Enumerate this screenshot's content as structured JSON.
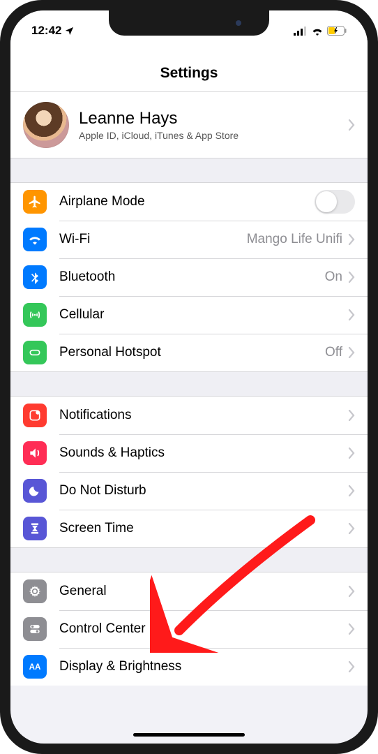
{
  "status": {
    "time": "12:42",
    "location_glyph": "➤"
  },
  "page": {
    "title": "Settings"
  },
  "profile": {
    "name": "Leanne Hays",
    "subtitle": "Apple ID, iCloud, iTunes & App Store"
  },
  "group1": {
    "airplane": {
      "label": "Airplane Mode",
      "on": false
    },
    "wifi": {
      "label": "Wi-Fi",
      "value": "Mango Life Unifi"
    },
    "bluetooth": {
      "label": "Bluetooth",
      "value": "On"
    },
    "cellular": {
      "label": "Cellular"
    },
    "hotspot": {
      "label": "Personal Hotspot",
      "value": "Off"
    }
  },
  "group2": {
    "notifications": {
      "label": "Notifications"
    },
    "sounds": {
      "label": "Sounds & Haptics"
    },
    "dnd": {
      "label": "Do Not Disturb"
    },
    "screentime": {
      "label": "Screen Time"
    }
  },
  "group3": {
    "general": {
      "label": "General"
    },
    "controlcenter": {
      "label": "Control Center"
    },
    "display": {
      "label": "Display & Brightness"
    }
  },
  "icon_colors": {
    "airplane": "#ff9500",
    "wifi": "#007aff",
    "bluetooth": "#007aff",
    "cellular": "#34c759",
    "hotspot": "#34c759",
    "notifications": "#ff3b30",
    "sounds": "#ff2d55",
    "dnd": "#5856d6",
    "screentime": "#5856d6",
    "general": "#8e8e93",
    "controlcenter": "#8e8e93",
    "display": "#007aff"
  }
}
